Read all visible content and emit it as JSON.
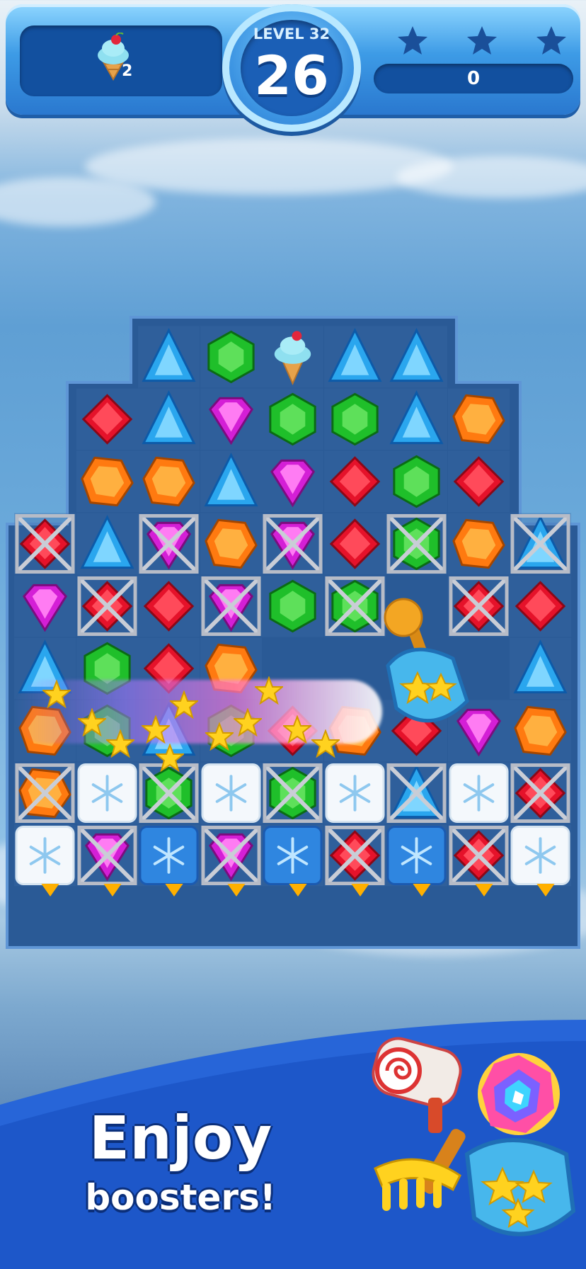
{
  "hud": {
    "level_label": "LEVEL 32",
    "moves_left": "26",
    "goal_count": "2",
    "goal_icon": "ice-cream-icon",
    "score": "0",
    "stars_earned": 0,
    "stars_total": 3
  },
  "board": {
    "cols": 9,
    "rows": 9,
    "grid": [
      [
        "",
        "",
        "blue",
        "green",
        "ice",
        "blue",
        "blue",
        "",
        ""
      ],
      [
        "",
        "red",
        "blue",
        "purple",
        "green",
        "green",
        "blue",
        "orange",
        ""
      ],
      [
        "",
        "orange",
        "orange",
        "blue",
        "purple",
        "red",
        "green",
        "red",
        ""
      ],
      [
        "red|c",
        "blue",
        "purple|c",
        "orange",
        "purple|c",
        "red",
        "green|c",
        "orange",
        "blue|c"
      ],
      [
        "purple",
        "red|c",
        "red",
        "purple|c",
        "green",
        "green|c",
        "",
        "red|c",
        "red"
      ],
      [
        "blue",
        "green",
        "red",
        "orange",
        "",
        "",
        "",
        "",
        "blue"
      ],
      [
        "orange",
        "green",
        "blue",
        "green",
        "red",
        "orange",
        "red",
        "purple",
        "orange"
      ],
      [
        "orange|c",
        "snow",
        "green|c",
        "snow",
        "green|c",
        "snow",
        "blue|c",
        "snow",
        "red|c"
      ],
      [
        "snow",
        "purple|c",
        "icesnow",
        "purple|c",
        "icesnow",
        "red|c",
        "icesnow",
        "red|c",
        "snow"
      ]
    ],
    "booster_in_play": "scoop-booster-icon"
  },
  "promo": {
    "line1": "Enjoy",
    "line2": "boosters!",
    "booster_icons": [
      "hammer-booster-icon",
      "rainbow-gem-booster-icon",
      "rake-booster-icon",
      "scoop-booster-icon"
    ]
  },
  "colors": {
    "board_bg": "#2a5a96",
    "cell_bg": "#3a6aa6",
    "accent": "#2a78cf"
  }
}
